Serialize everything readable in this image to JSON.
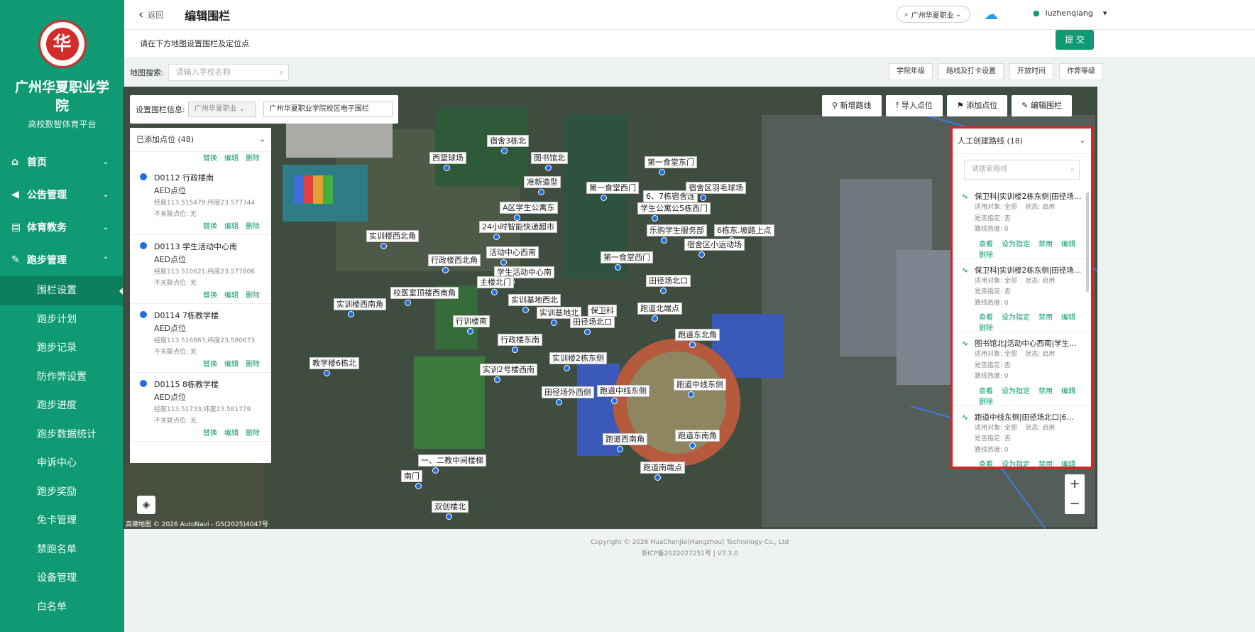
{
  "sidebar": {
    "logo_char": "华",
    "school_name": "广州华夏职业学院",
    "platform": "高校数智体育平台",
    "menu": [
      {
        "label": "首页",
        "icon": "home-icon"
      },
      {
        "label": "公告管理",
        "icon": "megaphone-icon"
      },
      {
        "label": "体育教务",
        "icon": "document-icon"
      },
      {
        "label": "跑步管理",
        "icon": "running-icon"
      }
    ],
    "submenu": [
      "围栏设置",
      "跑步计划",
      "跑步记录",
      "防作弊设置",
      "跑步进度",
      "跑步数据统计",
      "申诉中心",
      "跑步奖励",
      "免卡管理",
      "禁跑名单",
      "设备管理",
      "白名单"
    ]
  },
  "header": {
    "back": "返回",
    "title": "编辑围栏",
    "school_select": "广州华夏职业",
    "username": "luzhenqiang"
  },
  "subbar": {
    "hint": "请在下方地图设置围栏及定位点",
    "submit": "提 交"
  },
  "search": {
    "label": "地图搜索:",
    "placeholder": "请输入学校名称"
  },
  "toolbar": [
    "学院年级",
    "路线及打卡设置",
    "开放时间",
    "作弊等级"
  ],
  "fence": {
    "label": "设置围栏信息:",
    "select": "广州华夏职业",
    "name": "广州华夏职业学院校区电子围栏"
  },
  "points_panel": {
    "title": "已添加点位 (48)",
    "actions": [
      "替换",
      "编辑",
      "删除"
    ],
    "points": [
      {
        "name": "D0112 行政楼南",
        "type": "AED点位",
        "coords": "经度113.515479;纬度23.577344",
        "link": "不关联点位: 无"
      },
      {
        "name": "D0113 学生活动中心南",
        "type": "AED点位",
        "coords": "经度113.510621;纬度23.577806",
        "link": "不关联点位: 无"
      },
      {
        "name": "D0114 7栋教学楼",
        "type": "AED点位",
        "coords": "经度113.516863;纬度23.580673",
        "link": "不关联点位: 无"
      },
      {
        "name": "D0115 8栋教学楼",
        "type": "AED点位",
        "coords": "经度113.51733;纬度23.581779",
        "link": "不关联点位: 无"
      }
    ]
  },
  "map_buttons": [
    "新增路线",
    "导入点位",
    "添加点位",
    "编辑围栏"
  ],
  "routes_panel": {
    "title": "人工创建路线 (18)",
    "search_placeholder": "请搜索路线",
    "actions": [
      "查看",
      "设为指定",
      "禁用",
      "编辑",
      "删除"
    ],
    "routes": [
      {
        "name": "保卫科|实训楼2栋东侧|田径场…",
        "target": "适用对象: 全部",
        "status": "状态: 启用",
        "fixed": "是否指定: 否",
        "heat": "路线热度: 0"
      },
      {
        "name": "保卫科|实训楼2栋东侧|田径场…",
        "target": "适用对象: 全部",
        "status": "状态: 启用",
        "fixed": "是否指定: 否",
        "heat": "路线热度: 0"
      },
      {
        "name": "图书馆北|活动中心西南|学生…",
        "target": "适用对象: 全部",
        "status": "状态: 启用",
        "fixed": "是否指定: 否",
        "heat": "路线热度: 0"
      },
      {
        "name": "跑道中线东侧|田径场北口|6…",
        "target": "适用对象: 全部",
        "status": "状态: 启用",
        "fixed": "是否指定: 否",
        "heat": "路线热度: 0"
      }
    ]
  },
  "map_labels": [
    "宿舍3栋北",
    "图书馆北",
    "西篮球场",
    "第一食堂东门",
    "准新造型",
    "第一食堂西门",
    "6、7栋宿舍连",
    "宿舍区羽毛球场",
    "A区学生公寓东",
    "学生公寓公5栋西门",
    "24小时智能快递超市",
    "乐购学生服务部",
    "6栋东.坡路上点",
    "实训楼西北角",
    "宿舍区小运动场",
    "活动中心西南",
    "行政楼西北角",
    "第一食堂西门",
    "学生活动中心南",
    "主楼北门",
    "田径场北口",
    "校医室顶楼西南角",
    "实训基地西北",
    "实训楼西南角",
    "保卫科",
    "实训基地北",
    "跑道北端点",
    "行训楼南",
    "田径场北口",
    "跑道东北角",
    "行政楼东南",
    "跑道东北角",
    "行政楼东南",
    "实训楼2栋东侧",
    "教学楼6栋北",
    "实训2号楼西南",
    "田径场外西侧",
    "跑道中线东侧",
    "跑道中线东侧",
    "跑道西南角",
    "跑道东南角",
    "一、二教中间楼梯",
    "跑道南端点",
    "南门",
    "双创楼北"
  ],
  "map_attrib": "高德地图  © 2026 AutoNavi - GS(2025)4047号",
  "footer": {
    "copyright": "Copyright © 2026 HuaChenJie(Hangzhou) Technology Co., Ltd",
    "icp": "浙ICP备2022027251号 | V7.3.0"
  }
}
